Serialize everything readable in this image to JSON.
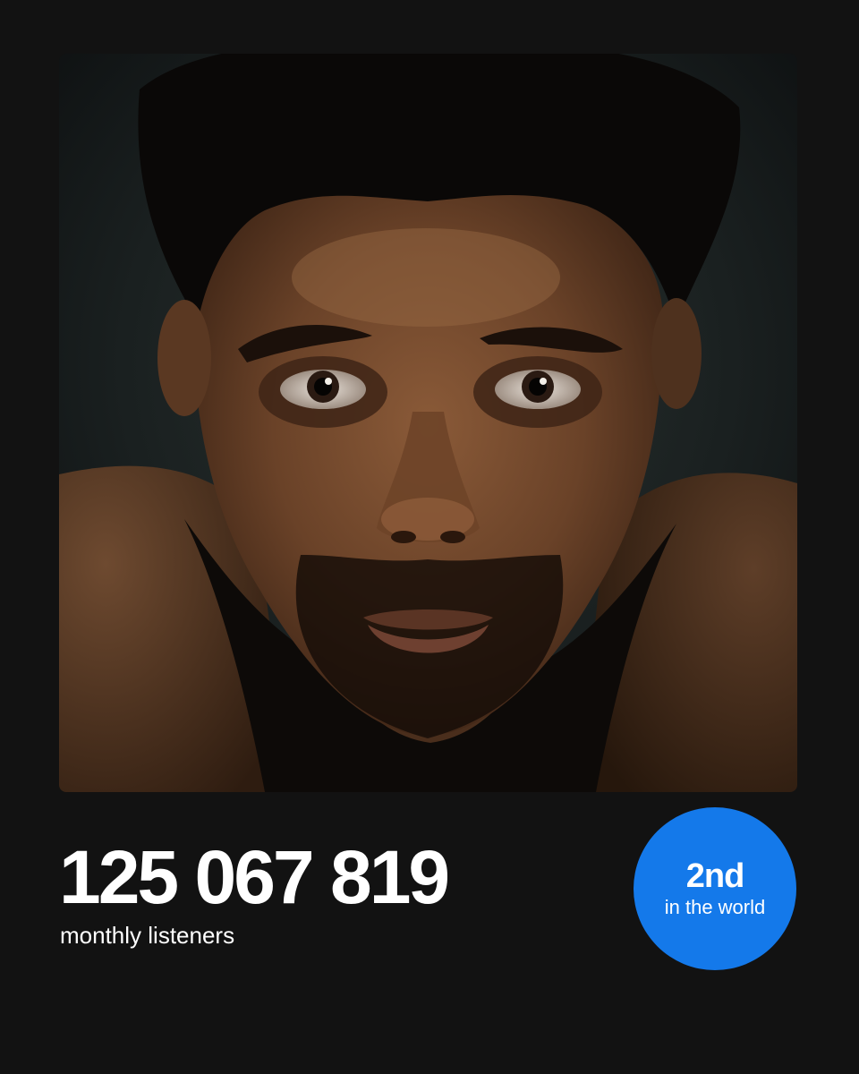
{
  "artist_card": {
    "monthly_listeners_value": "125 067 819",
    "monthly_listeners_label": "monthly listeners",
    "rank": {
      "value": "2nd",
      "caption": "in the world",
      "badge_color": "#1479ea"
    },
    "background_color": "#121212"
  }
}
